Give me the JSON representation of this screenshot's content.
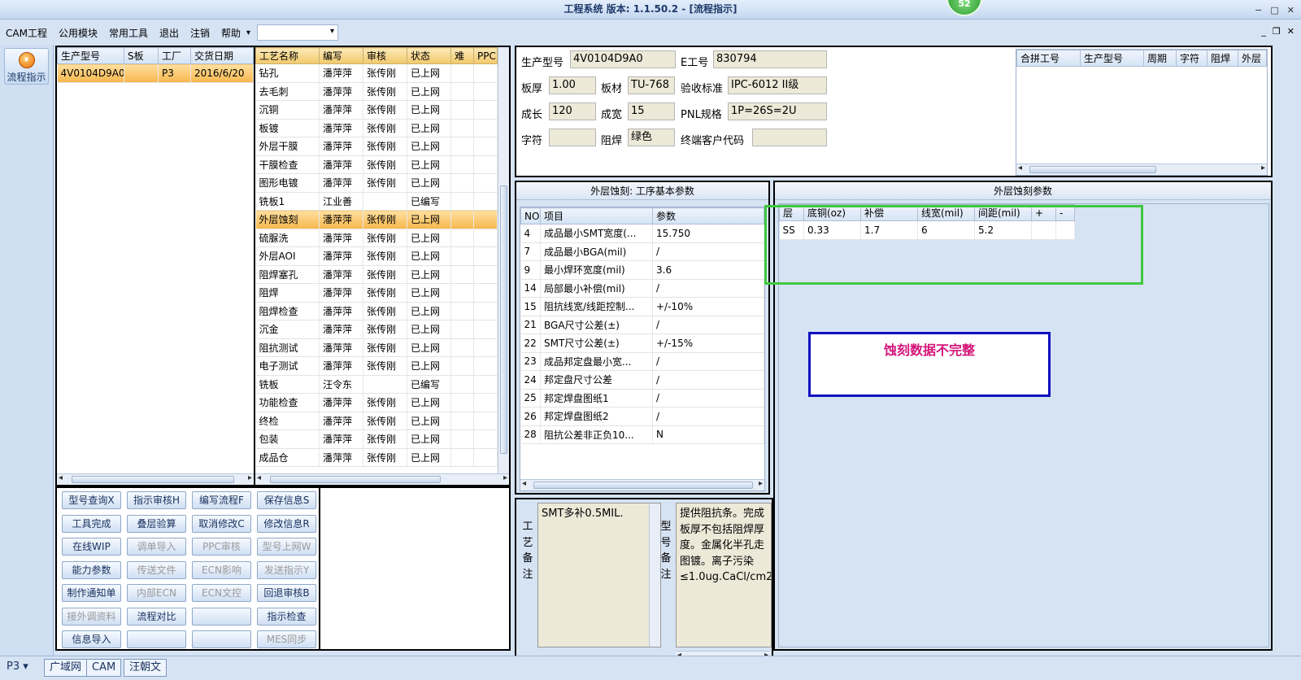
{
  "window": {
    "title": "工程系统  版本: 1.1.50.2 - [流程指示]",
    "badge": "52",
    "min": "−",
    "max": "□",
    "close": "✕"
  },
  "menu": {
    "items": [
      "CAM工程",
      "公用模块",
      "常用工具",
      "退出",
      "注销",
      "帮助"
    ],
    "dropdown_arrow": "▾",
    "combo_value": "",
    "mdi_min": "_",
    "mdi_restore": "❐",
    "mdi_close": "✕"
  },
  "rail": {
    "flow_button": "流程指示",
    "flow_icon": "⏸"
  },
  "orders": {
    "headers": [
      "生产型号",
      "S板",
      "工厂",
      "交货日期"
    ],
    "rows": [
      [
        "4V0104D9A0",
        "",
        "P3",
        "2016/6/20"
      ]
    ]
  },
  "process": {
    "headers": [
      "工艺名称",
      "编写",
      "审核",
      "状态",
      "难",
      "PPC"
    ],
    "rows": [
      [
        "钻孔",
        "潘萍萍",
        "张传刚",
        "已上网"
      ],
      [
        "去毛刺",
        "潘萍萍",
        "张传刚",
        "已上网"
      ],
      [
        "沉铜",
        "潘萍萍",
        "张传刚",
        "已上网"
      ],
      [
        "板镀",
        "潘萍萍",
        "张传刚",
        "已上网"
      ],
      [
        "外层干膜",
        "潘萍萍",
        "张传刚",
        "已上网"
      ],
      [
        "干膜检查",
        "潘萍萍",
        "张传刚",
        "已上网"
      ],
      [
        "图形电镀",
        "潘萍萍",
        "张传刚",
        "已上网"
      ],
      [
        "铣板1",
        "江业善",
        "",
        "已编写"
      ],
      [
        "外层蚀刻",
        "潘萍萍",
        "张传刚",
        "已上网"
      ],
      [
        "硫脲洗",
        "潘萍萍",
        "张传刚",
        "已上网"
      ],
      [
        "外层AOI",
        "潘萍萍",
        "张传刚",
        "已上网"
      ],
      [
        "阻焊塞孔",
        "潘萍萍",
        "张传刚",
        "已上网"
      ],
      [
        "阻焊",
        "潘萍萍",
        "张传刚",
        "已上网"
      ],
      [
        "阻焊检查",
        "潘萍萍",
        "张传刚",
        "已上网"
      ],
      [
        "沉金",
        "潘萍萍",
        "张传刚",
        "已上网"
      ],
      [
        "阻抗测试",
        "潘萍萍",
        "张传刚",
        "已上网"
      ],
      [
        "电子测试",
        "潘萍萍",
        "张传刚",
        "已上网"
      ],
      [
        "铣板",
        "汪令东",
        "",
        "已编写"
      ],
      [
        "功能检查",
        "潘萍萍",
        "张传刚",
        "已上网"
      ],
      [
        "终检",
        "潘萍萍",
        "张传刚",
        "已上网"
      ],
      [
        "包装",
        "潘萍萍",
        "张传刚",
        "已上网"
      ],
      [
        "成品仓",
        "潘萍萍",
        "张传刚",
        "已上网"
      ]
    ],
    "selected_index": 8
  },
  "buttons": [
    {
      "label": "型号查询X",
      "enabled": true
    },
    {
      "label": "指示审核H",
      "enabled": true
    },
    {
      "label": "编写流程F",
      "enabled": true
    },
    {
      "label": "保存信息S",
      "enabled": true
    },
    {
      "label": "工具完成",
      "enabled": true
    },
    {
      "label": "叠层验算",
      "enabled": true
    },
    {
      "label": "取消修改C",
      "enabled": true
    },
    {
      "label": "修改信息R",
      "enabled": true
    },
    {
      "label": "在线WIP",
      "enabled": true
    },
    {
      "label": "调单导入",
      "enabled": false
    },
    {
      "label": "PPC审核",
      "enabled": false
    },
    {
      "label": "型号上网W",
      "enabled": false
    },
    {
      "label": "能力参数",
      "enabled": true
    },
    {
      "label": "传送文件",
      "enabled": false
    },
    {
      "label": "ECN影响",
      "enabled": false
    },
    {
      "label": "发送指示Y",
      "enabled": false
    },
    {
      "label": "制作通知单",
      "enabled": true
    },
    {
      "label": "内部ECN",
      "enabled": false
    },
    {
      "label": "ECN文控",
      "enabled": false
    },
    {
      "label": "回退审核B",
      "enabled": true
    },
    {
      "label": "接外调资料",
      "enabled": false
    },
    {
      "label": "流程对比",
      "enabled": true
    },
    {
      "label": "",
      "enabled": true
    },
    {
      "label": "指示检查",
      "enabled": true
    },
    {
      "label": "信息导入",
      "enabled": true
    },
    {
      "label": "",
      "enabled": true
    },
    {
      "label": "",
      "enabled": true
    },
    {
      "label": "MES同步",
      "enabled": false
    }
  ],
  "info": {
    "model_label": "生产型号",
    "model_value": "4V0104D9A0",
    "eno_label": "E工号",
    "eno_value": "830794",
    "thick_label": "板厚",
    "thick_value": "1.00",
    "mat_label": "板材",
    "mat_value": "TU-768",
    "std_label": "验收标准",
    "std_value": "IPC-6012 II级",
    "len_label": "成长",
    "len_value": "120",
    "wid_label": "成宽",
    "wid_value": "15",
    "pnl_label": "PNL规格",
    "pnl_value": "1P=26S=2U",
    "char_label": "字符",
    "char_value": "",
    "mask_label": "阻焊",
    "mask_value": "绿色",
    "cust_label": "终端客户代码",
    "cust_value": ""
  },
  "combined": {
    "headers": [
      "合拼工号",
      "生产型号",
      "周期",
      "字符",
      "阻焊",
      "外层"
    ]
  },
  "params": {
    "title": "外层蚀刻: 工序基本参数",
    "headers": [
      "NO",
      "项目",
      "参数"
    ],
    "rows": [
      [
        "4",
        "成品最小SMT宽度(...",
        "15.750"
      ],
      [
        "7",
        "成品最小BGA(mil)",
        "/"
      ],
      [
        "9",
        "最小焊环宽度(mil)",
        "3.6"
      ],
      [
        "14",
        "局部最小补偿(mil)",
        "/"
      ],
      [
        "15",
        "阻抗线宽/线距控制...",
        "+/-10%"
      ],
      [
        "21",
        "BGA尺寸公差(±)",
        "/"
      ],
      [
        "22",
        "SMT尺寸公差(±)",
        "+/-15%"
      ],
      [
        "23",
        "成品邦定盘最小宽...",
        "/"
      ],
      [
        "24",
        "邦定盘尺寸公差",
        "/"
      ],
      [
        "25",
        "邦定焊盘图纸1",
        "/"
      ],
      [
        "26",
        "邦定焊盘图纸2",
        "/"
      ],
      [
        "28",
        "阻抗公差非正负10...",
        "N"
      ]
    ]
  },
  "etch": {
    "title": "外层蚀刻参数",
    "headers": [
      "层",
      "底铜(oz)",
      "补偿",
      "线宽(mil)",
      "间距(mil)",
      "+",
      "-"
    ],
    "rows": [
      [
        "SS",
        "0.33",
        "1.7",
        "6",
        "5.2",
        "",
        ""
      ]
    ],
    "warning": "蚀刻数据不完整",
    "warning_color": "#d4147a",
    "highlight_color": "#3fc83f",
    "warning_border": "#1010c0"
  },
  "notes": {
    "process_label": "工艺备注",
    "process_text": "SMT多补0.5MIL.",
    "model_label": "型号备注",
    "model_text": "提供阻抗条。完成板厚不包括阻焊厚度。金属化半孔走图镀。离子污染≤1.0ug.CaCl/cm2"
  },
  "status": {
    "combo": "P3",
    "tabs": [
      "广域网",
      "CAM",
      "汪朝文"
    ]
  }
}
